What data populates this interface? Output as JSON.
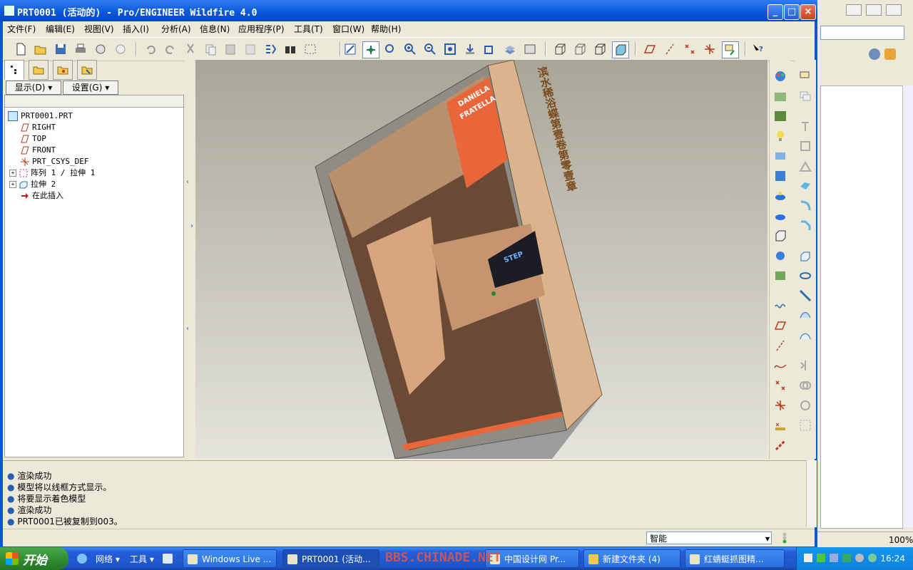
{
  "window": {
    "title": "PRT0001 (活动的) - Pro/ENGINEER Wildfire 4.0",
    "minimize_label": "_",
    "maximize_label": "□",
    "close_label": "×"
  },
  "menubar": {
    "items": [
      "文件(F)",
      "编辑(E)",
      "视图(V)",
      "插入(I)",
      "分析(A)",
      "信息(N)",
      "应用程序(P)",
      "工具(T)",
      "窗口(W)",
      "帮助(H)"
    ]
  },
  "toolbar": {
    "icons": [
      "new-icon",
      "open-icon",
      "save-icon",
      "print-icon",
      "email-icon",
      "email-link-icon",
      "undo-icon",
      "redo-icon",
      "cut-icon",
      "copy-icon",
      "paste-icon",
      "paste-special-icon",
      "regenerate-icon",
      "find-icon",
      "select-box-icon",
      "repaint-icon",
      "spin-center-icon",
      "orient-icon",
      "zoom-in-icon",
      "zoom-out-icon",
      "refit-icon",
      "reorient-icon",
      "saved-views-icon",
      "layers-icon",
      "view-manager-icon",
      "wireframe-icon",
      "hidden-line-icon",
      "no-hidden-icon",
      "shading-icon",
      "datum-planes-icon",
      "datum-axes-icon",
      "datum-points-icon",
      "csys-icon",
      "annotations-icon",
      "context-help-icon"
    ]
  },
  "navigator": {
    "show_button": "显示(D)",
    "settings_button": "设置(G)",
    "tree": [
      {
        "label": "PRT0001.PRT",
        "icon": "part-icon"
      },
      {
        "label": "RIGHT",
        "icon": "datum-plane-icon"
      },
      {
        "label": "TOP",
        "icon": "datum-plane-icon"
      },
      {
        "label": "FRONT",
        "icon": "datum-plane-icon"
      },
      {
        "label": "PRT_CSYS_DEF",
        "icon": "csys-icon"
      },
      {
        "label": "阵列 1 / 拉伸 1",
        "icon": "pattern-icon"
      },
      {
        "label": "拉伸 2",
        "icon": "extrude-icon"
      },
      {
        "label": "在此插入",
        "icon": "insert-arrow-icon"
      }
    ]
  },
  "viewport": {
    "cover_name_lines": [
      "DANIELA",
      "FRATELLA"
    ],
    "spine_text": "滨水稀浴蝶第壹卷第零壹章",
    "badge_text": "STEP"
  },
  "messages": [
    "渲染成功",
    "模型将以线框方式显示。",
    "将要显示着色模型",
    "渲染成功",
    "PRT0001已被复制到003。"
  ],
  "statusbar": {
    "filter_value": "智能"
  },
  "background_window": {
    "zoom": "100%"
  },
  "taskbar": {
    "start_label": "开始",
    "quick_items": [
      "网络",
      "工具"
    ],
    "tasks": [
      "Windows Live ...",
      "PRT0001 (活动...",
      "中国设计网 Pr...",
      "新建文件夹 (4)",
      "红蜻蜓抓图精..."
    ],
    "clock": "16:24",
    "watermark": "BBS.CHINADE.NET"
  }
}
